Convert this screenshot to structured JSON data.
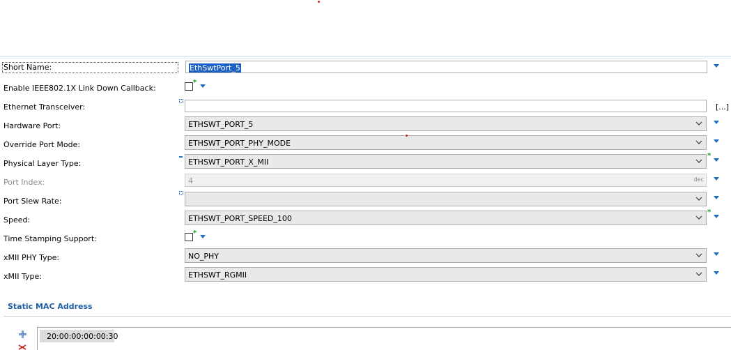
{
  "form": {
    "short_name": {
      "label": "Short Name:",
      "value": "EthSwtPort_5"
    },
    "ieee_callback": {
      "label": "Enable IEEE802.1X Link Down Callback:"
    },
    "transceiver": {
      "label": "Ethernet Transceiver:",
      "value": "",
      "browse": "[...]"
    },
    "hardware_port": {
      "label": "Hardware Port:",
      "value": "ETHSWT_PORT_5"
    },
    "override_mode": {
      "label": "Override Port Mode:",
      "value": "ETHSWT_PORT_PHY_MODE"
    },
    "phy_layer": {
      "label": "Physical Layer Type:",
      "value": "ETHSWT_PORT_X_MII"
    },
    "port_index": {
      "label": "Port Index:",
      "value": "4",
      "unit": "dec"
    },
    "slew_rate": {
      "label": "Port Slew Rate:",
      "value": ""
    },
    "speed": {
      "label": "Speed:",
      "value": "ETHSWT_PORT_SPEED_100"
    },
    "time_stamping": {
      "label": "Time Stamping Support:"
    },
    "xmii_phy": {
      "label": "xMII PHY Type:",
      "value": "NO_PHY"
    },
    "xmii_type": {
      "label": "xMII Type:",
      "value": "ETHSWT_RGMII"
    }
  },
  "static_mac": {
    "title": "Static MAC Address",
    "items": [
      "20:00:00:00:00:30"
    ]
  },
  "colors": {
    "accent": "#1a6fc2",
    "section_title": "#1f5fa8",
    "selection": "#1c62c4",
    "modified_star": "#1a9a1a"
  }
}
